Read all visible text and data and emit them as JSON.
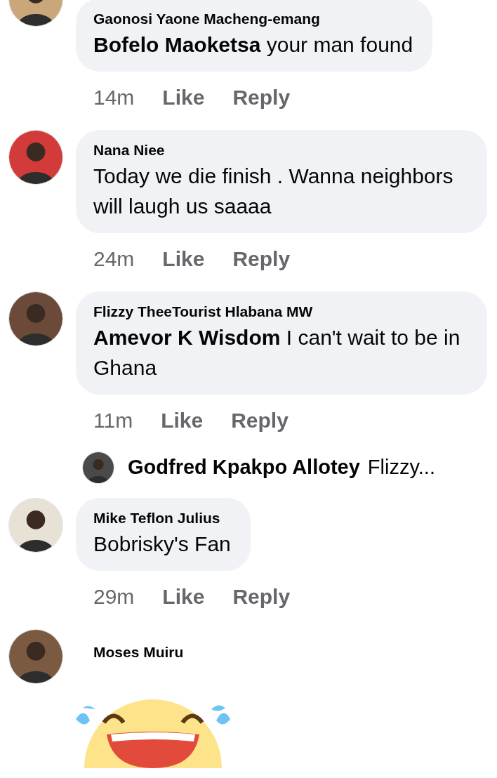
{
  "comments": [
    {
      "kind": "text",
      "author": "Gaonosi Yaone Macheng-emang",
      "text": "**Bofelo Maoketsa**  your man found",
      "time": "14m",
      "actions": [
        "Like",
        "Reply"
      ]
    },
    {
      "kind": "text",
      "author": "Nana Niee",
      "text": "Today we die finish . Wanna neighbors will laugh us saaaa",
      "time": "24m",
      "actions": [
        "Like",
        "Reply"
      ]
    },
    {
      "kind": "text",
      "author": "Flizzy TheeTourist Hlabana MW",
      "text": "**Amevor K Wisdom** I can't wait to be in Ghana",
      "time": "11m",
      "actions": [
        "Like",
        "Reply"
      ],
      "reply_preview": {
        "author": "Godfred Kpakpo Allotey",
        "text": "Flizzy..."
      }
    },
    {
      "kind": "text",
      "author": "Mike Teflon Julius",
      "text": "Bobrisky's Fan",
      "time": "29m",
      "actions": [
        "Like",
        "Reply"
      ]
    },
    {
      "kind": "sticker",
      "author": "Moses Muiru"
    }
  ]
}
